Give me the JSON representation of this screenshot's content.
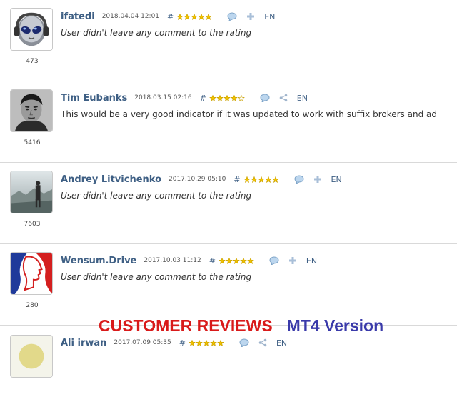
{
  "reviews": [
    {
      "author": "ifatedi",
      "date": "2018.04.04 12:01",
      "hash": "#",
      "rating": 5,
      "share_icon": "plus-icon",
      "lang": "EN",
      "comment": "User didn't leave any comment to the rating",
      "count": "473",
      "avatar": "alien-headphones-avatar"
    },
    {
      "author": "Tim Eubanks",
      "date": "2018.03.15 02:16",
      "hash": "#",
      "rating": 4,
      "share_icon": "share-icon",
      "lang": "EN",
      "comment": "This would be a very good indicator if it was updated to work with suffix brokers and ad",
      "count": "5416",
      "avatar": "man-portrait-avatar"
    },
    {
      "author": "Andrey Litvichenko",
      "date": "2017.10.29 05:10",
      "hash": "#",
      "rating": 5,
      "share_icon": "plus-icon",
      "lang": "EN",
      "comment": "User didn't leave any comment to the rating",
      "count": "7603",
      "avatar": "figure-landscape-avatar"
    },
    {
      "author": "Wensum.Drive",
      "date": "2017.10.03 11:12",
      "hash": "#",
      "rating": 5,
      "share_icon": "plus-icon",
      "lang": "EN",
      "comment": "User didn't leave any comment to the rating",
      "count": "280",
      "avatar": "silhouette-profile-avatar"
    },
    {
      "author": "Ali irwan",
      "date": "2017.07.09 05:35",
      "hash": "#",
      "rating": 5,
      "share_icon": "share-icon",
      "lang": "EN"
    }
  ],
  "banner": {
    "title": "CUSTOMER REVIEWS",
    "subtitle": "MT4 Version"
  },
  "colors": {
    "link": "#3e5f84",
    "star": "#f2c200",
    "banner_red": "#d91a1a",
    "banner_blue": "#3a3aaa"
  }
}
